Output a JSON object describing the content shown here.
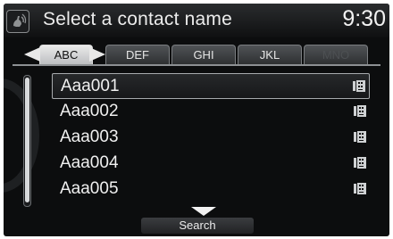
{
  "header": {
    "title": "Select a contact name",
    "time": "9:30",
    "voice_icon": "voice-talk-icon"
  },
  "tabs": [
    {
      "label": "ABC",
      "state": "active"
    },
    {
      "label": "DEF",
      "state": "normal"
    },
    {
      "label": "GHI",
      "state": "normal"
    },
    {
      "label": "JKL",
      "state": "normal"
    },
    {
      "label": "MNO",
      "state": "disabled"
    }
  ],
  "contacts": [
    {
      "name": "Aaa001",
      "icon": "phonebook-icon",
      "selected": true
    },
    {
      "name": "Aaa002",
      "icon": "phonebook-icon",
      "selected": false
    },
    {
      "name": "Aaa003",
      "icon": "phonebook-icon",
      "selected": false
    },
    {
      "name": "Aaa004",
      "icon": "phonebook-icon",
      "selected": false
    },
    {
      "name": "Aaa005",
      "icon": "phonebook-icon",
      "selected": false
    }
  ],
  "footer": {
    "search_label": "Search",
    "arrow_icon": "chevron-down-icon"
  },
  "colors": {
    "screen_bg": "#0c0d0e",
    "text": "#f0f0f0",
    "active_tab": "#eaeaea",
    "disabled_tab_text": "#4d5053"
  }
}
